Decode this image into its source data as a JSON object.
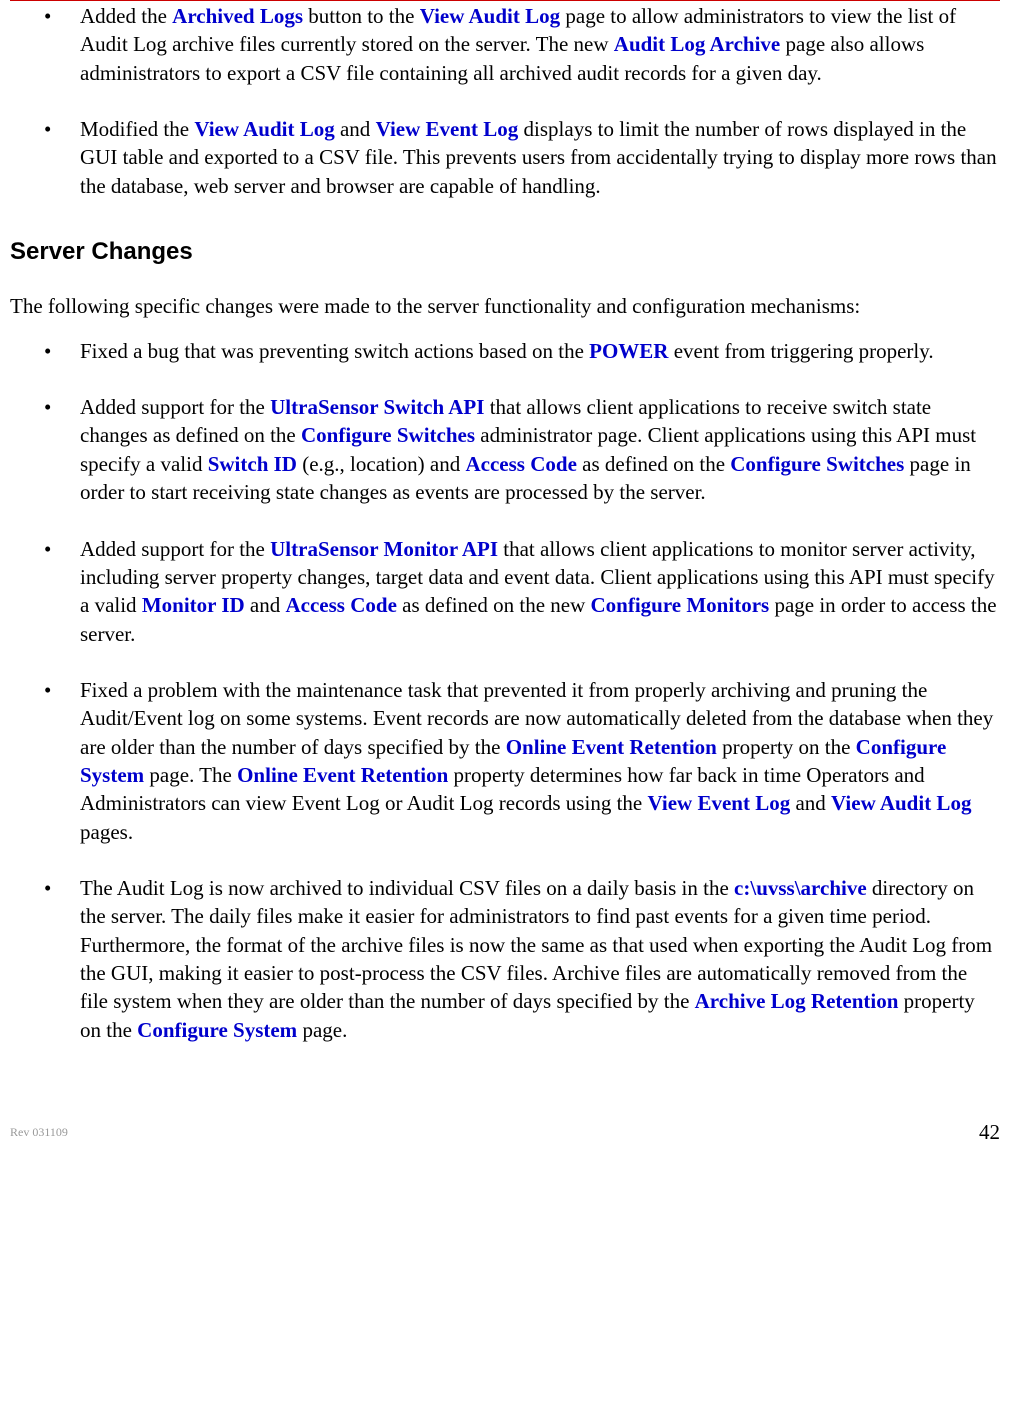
{
  "bullets1": [
    {
      "t1": "Added the ",
      "e1": "Archived Logs",
      "t2": " button to the ",
      "e2": "View Audit Log",
      "t3": " page to allow administrators to view the list of Audit Log archive files currently stored on the server.  The new ",
      "e3": "Audit Log Archive",
      "t4": " page also allows administrators to export a CSV file containing all archived audit records for a given day."
    },
    {
      "t1": "Modified the ",
      "e1": "View Audit Log",
      "t2": " and ",
      "e2": "View Event Log",
      "t3": " displays to limit the number of rows displayed in the GUI table and exported to a CSV file.  This prevents users from accidentally trying to display more rows than the database, web server and browser are capable of handling."
    }
  ],
  "heading": "Server Changes",
  "intro": "The following specific changes were made to the server functionality and configuration mechanisms:",
  "bullets2": [
    {
      "t1": "Fixed a bug that was preventing switch actions based on the ",
      "e1": "POWER",
      "t2": " event from triggering properly."
    },
    {
      "t1": "Added support for the ",
      "e1": "UltraSensor Switch API",
      "t2": " that allows client applications to receive switch state changes as defined on the ",
      "e2": "Configure Switches",
      "t3": " administrator page.  Client applications using this API must specify a valid ",
      "e3": "Switch ID",
      "t4": " (e.g., location) and ",
      "e4": "Access Code",
      "t5": " as defined on the ",
      "e5": "Configure Switches",
      "t6": " page in order to start receiving state changes as events are processed by the server."
    },
    {
      "t1": "Added support for the ",
      "e1": "UltraSensor Monitor API",
      "t2": " that allows client applications to monitor server activity, including server property changes, target data and event data.  Client applications using this API must specify a valid ",
      "e2": "Monitor ID",
      "t3": " and ",
      "e3": "Access Code",
      "t4": " as defined on the new ",
      "e4": "Configure Monitors",
      "t5": " page in order to access the server."
    },
    {
      "t1": "Fixed a problem with the maintenance task that prevented it from properly archiving and pruning the Audit/Event log on some systems.  Event records are now automatically deleted from the database when they are older than the number of days specified by the ",
      "e1": "Online Event Retention",
      "t2": " property on the ",
      "e2": "Configure System",
      "t3": " page. The ",
      "e3": "Online Event Retention",
      "t4": " property determines how far back in time Operators and Administrators can view Event Log or Audit Log records using the ",
      "e4": "View Event Log",
      "t5": " and ",
      "e5": "View Audit Log",
      "t6": " pages."
    },
    {
      "t1": "The Audit Log is now archived to individual CSV files on a daily basis in the ",
      "e1": "c:\\uvss\\archive",
      "t2": " directory on the server.  The daily files make it easier for administrators to find past events for a given time period.  Furthermore, the format of the archive files is now the same as that used when exporting the Audit Log from the GUI, making it easier to post-process the CSV files. Archive files are automatically removed from the file system when they are older than the number of days specified by the ",
      "e2": "Archive Log Retention",
      "t3": " property on the ",
      "e3": "Configure System",
      "t4": " page."
    }
  ],
  "footer": "Rev 031109",
  "page": "42"
}
